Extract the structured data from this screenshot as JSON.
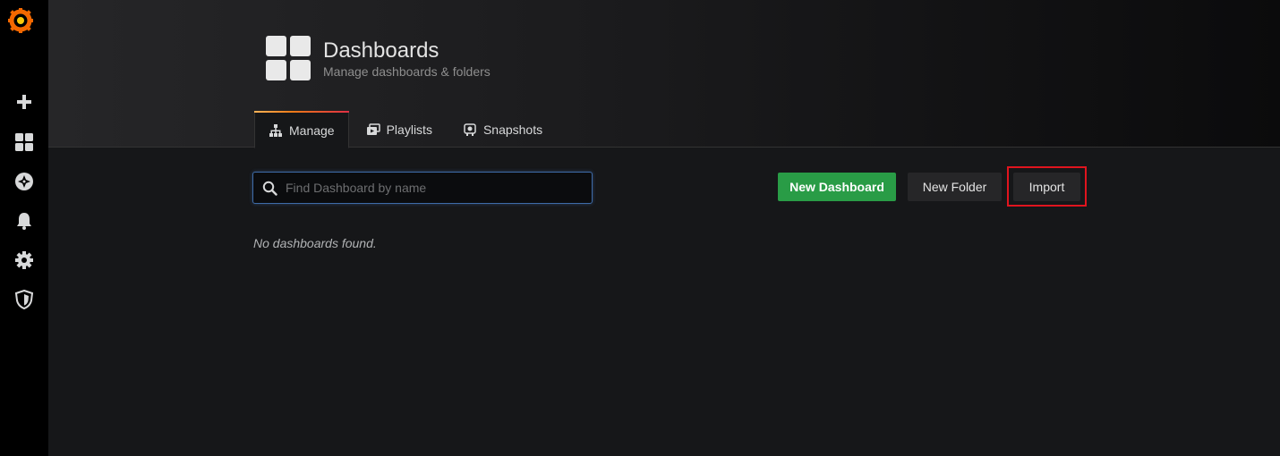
{
  "sidebar": {
    "logo": "grafana-logo-icon",
    "items": [
      {
        "icon": "plus-icon",
        "label": "Create"
      },
      {
        "icon": "dashboards-grid-icon",
        "label": "Dashboards"
      },
      {
        "icon": "compass-icon",
        "label": "Explore"
      },
      {
        "icon": "bell-icon",
        "label": "Alerting"
      },
      {
        "icon": "gear-icon",
        "label": "Configuration"
      },
      {
        "icon": "shield-icon",
        "label": "Server Admin"
      }
    ]
  },
  "header": {
    "title": "Dashboards",
    "subtitle": "Manage dashboards & folders",
    "icon": "dashboards-grid-icon"
  },
  "tabs": [
    {
      "label": "Manage",
      "icon": "sitemap-icon",
      "active": true
    },
    {
      "label": "Playlists",
      "icon": "playlist-icon",
      "active": false
    },
    {
      "label": "Snapshots",
      "icon": "snapshot-icon",
      "active": false
    }
  ],
  "search": {
    "placeholder": "Find Dashboard by name",
    "value": ""
  },
  "actions": {
    "new_dashboard": "New Dashboard",
    "new_folder": "New Folder",
    "import": "Import"
  },
  "empty_message": "No dashboards found.",
  "colors": {
    "accent_orange": "#eb7b18",
    "primary_green": "#299c46",
    "highlight_red": "#e0141e"
  }
}
